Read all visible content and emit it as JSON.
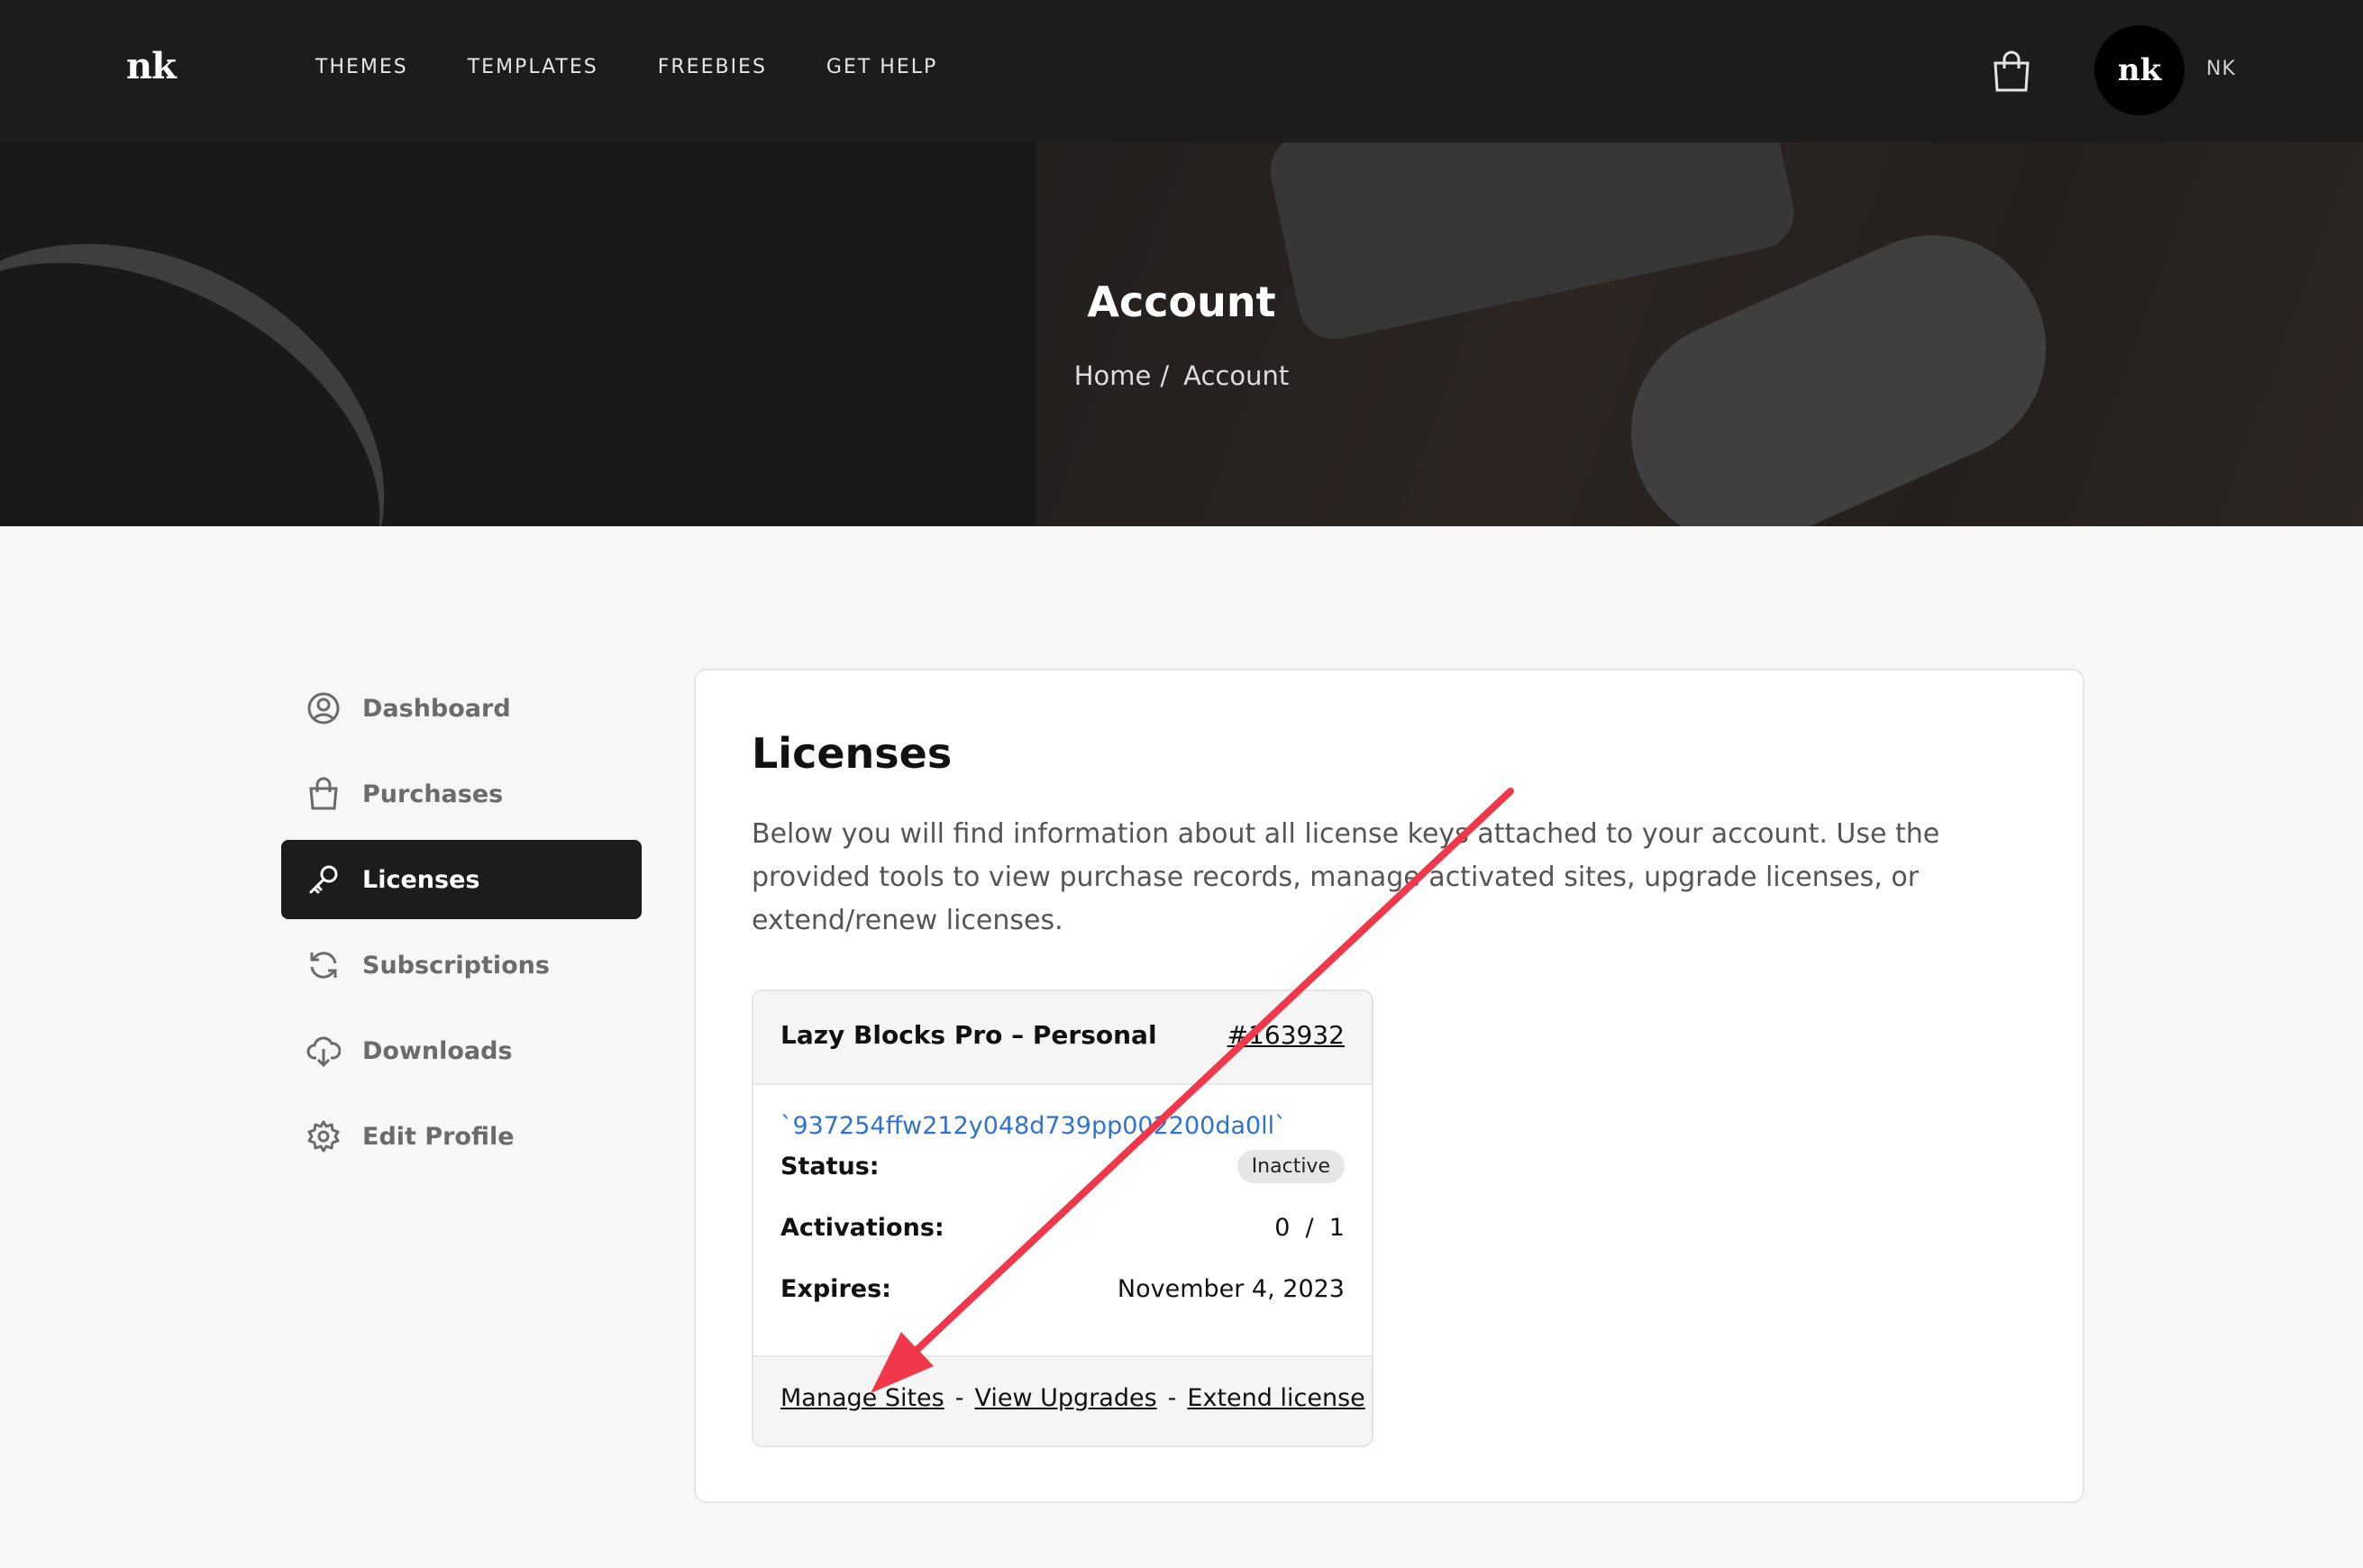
{
  "header": {
    "logo": "nk",
    "nav": [
      "THEMES",
      "TEMPLATES",
      "FREEBIES",
      "GET HELP"
    ],
    "avatar_text": "nk",
    "username": "NK"
  },
  "hero": {
    "title": "Account",
    "breadcrumb_home": "Home",
    "breadcrumb_sep": "/",
    "breadcrumb_current": "Account"
  },
  "sidebar": {
    "items": [
      {
        "label": "Dashboard",
        "icon": "user-circle-icon"
      },
      {
        "label": "Purchases",
        "icon": "shopping-bag-icon"
      },
      {
        "label": "Licenses",
        "icon": "key-icon",
        "active": true
      },
      {
        "label": "Subscriptions",
        "icon": "refresh-icon"
      },
      {
        "label": "Downloads",
        "icon": "cloud-download-icon"
      },
      {
        "label": "Edit Profile",
        "icon": "gear-icon"
      }
    ]
  },
  "main": {
    "title": "Licenses",
    "intro": "Below you will find information about all license keys attached to your account. Use the provided tools to view purchase records, manage activated sites, upgrade licenses, or extend/renew licenses.",
    "license": {
      "name": "Lazy Blocks Pro – Personal",
      "id": "#163932",
      "key": "`937254ffw212y048d739pp002200da0ll`",
      "status_label": "Status:",
      "status_value": "Inactive",
      "activations_label": "Activations:",
      "activations_value": "0  /  1",
      "expires_label": "Expires:",
      "expires_value": "November 4, 2023",
      "link_manage": "Manage Sites",
      "link_upgrades": "View Upgrades",
      "link_extend": "Extend license",
      "link_sep": "-"
    }
  },
  "colors": {
    "header_bg": "#1c1c1c",
    "accent_link": "#2f72d0",
    "arrow": "#f0384a"
  }
}
